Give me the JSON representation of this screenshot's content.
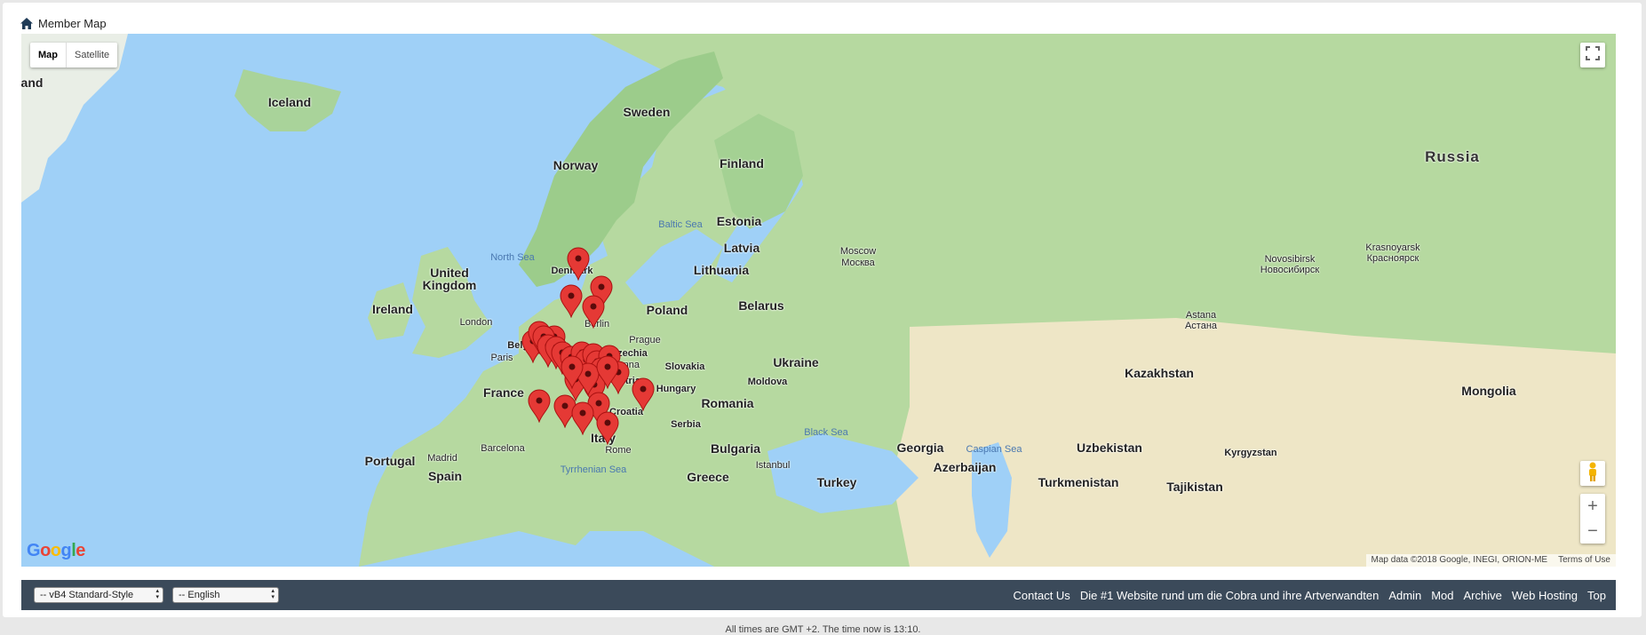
{
  "breadcrumb": {
    "icon": "home-icon",
    "title": "Member Map"
  },
  "map": {
    "map_types": [
      "Map",
      "Satellite"
    ],
    "active_type": "Map",
    "fullscreen_icon": "fullscreen-icon",
    "pegman_icon": "pegman-icon",
    "zoom_in": "+",
    "zoom_out": "−",
    "logo": "Google",
    "attribution": "Map data ©2018 Google, INEGI, ORION-ME",
    "terms": "Terms of Use",
    "pin_color": "#e53935",
    "labels": {
      "and": "and",
      "iceland": "Iceland",
      "sweden": "Sweden",
      "norway": "Norway",
      "finland": "Finland",
      "russia": "Russia",
      "baltic_sea": "Baltic Sea",
      "estonia": "Estonia",
      "north_sea": "North Sea",
      "latvia": "Latvia",
      "moscow": "Moscow",
      "moscow_ru": "Москва",
      "novosibirsk": "Novosibirsk",
      "novosibirsk_ru": "Новосибирск",
      "krasnoyarsk": "Krasnoyarsk",
      "krasnoyarsk_ru": "Красноярск",
      "denmark": "Denmark",
      "united_kingdom_1": "United",
      "united_kingdom_2": "Kingdom",
      "lithuania": "Lithuania",
      "ireland": "Ireland",
      "poland": "Poland",
      "belarus": "Belarus",
      "london": "London",
      "berlin": "Berlin",
      "astana": "Astana",
      "astana_kz": "Астана",
      "belgium": "Belgium",
      "prague": "Prague",
      "czechia": "Czechia",
      "paris": "Paris",
      "vienna": "Vienna",
      "slovakia": "Slovakia",
      "ukraine": "Ukraine",
      "kazakhstan": "Kazakhstan",
      "austria": "Austria",
      "moldova": "Moldova",
      "mongolia": "Mongolia",
      "france": "France",
      "hungary": "Hungary",
      "romania": "Romania",
      "croatia": "Croatia",
      "serbia": "Serbia",
      "black_sea": "Black Sea",
      "italy": "Italy",
      "georgia": "Georgia",
      "caspian_sea": "Caspian Sea",
      "uzbekistan": "Uzbekistan",
      "barcelona": "Barcelona",
      "rome": "Rome",
      "bulgaria": "Bulgaria",
      "kyrgyzstan": "Kyrgyzstan",
      "portugal": "Portugal",
      "madrid": "Madrid",
      "istanbul": "Istanbul",
      "azerbaijan": "Azerbaijan",
      "spain": "Spain",
      "tyrrhenian_sea": "Tyrrhenian Sea",
      "greece": "Greece",
      "turkey": "Turkey",
      "turkmenistan": "Turkmenistan",
      "tajikistan": "Tajikistan"
    }
  },
  "footer": {
    "style_select": "-- vB4 Standard-Style",
    "language_select": "-- English",
    "links": [
      "Contact Us",
      "Die #1 Website rund um die Cobra und ihre Artverwandten",
      "Admin",
      "Mod",
      "Archive",
      "Web Hosting",
      "Top"
    ]
  },
  "timezone_text": "All times are GMT +2. The time now is 13:10."
}
